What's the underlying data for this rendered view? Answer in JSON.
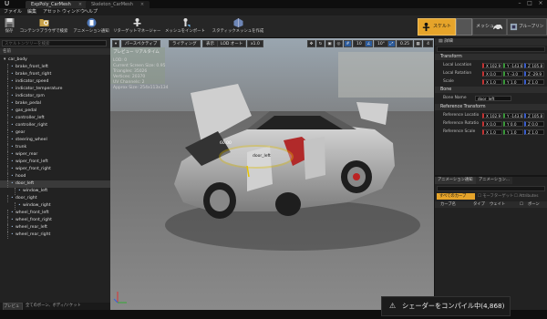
{
  "tabs": [
    {
      "label": "ExpPoly_CarMesh",
      "close": "×"
    },
    {
      "label": "Skeleton_CarMesh",
      "close": "×"
    }
  ],
  "window_controls": {
    "min": "–",
    "max": "□",
    "close": "×"
  },
  "menu": [
    "ファイル",
    "編集",
    "アセット",
    "ウィンドウ",
    "ヘルプ"
  ],
  "toolbar": {
    "buttons": [
      {
        "label": "保存",
        "icon": "save-icon"
      },
      {
        "label": "コンテンツブラウザで検索",
        "icon": "browse-icon"
      },
      {
        "label": "アニメーション通知",
        "icon": "notify-icon"
      },
      {
        "label": "リターゲットマネージャー",
        "icon": "retarget-icon"
      },
      {
        "label": "メッシュをインポート",
        "icon": "import-mesh-icon"
      },
      {
        "label": "スタティックメッシュを作成",
        "icon": "static-mesh-icon"
      }
    ],
    "modes": {
      "skeleton": "スケルトン",
      "mesh": "メッシュ",
      "blueprint": "ブループリント"
    }
  },
  "left_panel": {
    "search_placeholder": "スケルトンツリーを検索",
    "column_header": "名前",
    "footer": "全てのボーン、ボディ/ソケット"
  },
  "bones": [
    {
      "name": "car_body",
      "depth": 0
    },
    {
      "name": "brake_front_left",
      "depth": 1
    },
    {
      "name": "brake_front_right",
      "depth": 1
    },
    {
      "name": "indicator_speed",
      "depth": 1
    },
    {
      "name": "indicator_temperature",
      "depth": 1
    },
    {
      "name": "indicator_rpm",
      "depth": 1
    },
    {
      "name": "brake_pedal",
      "depth": 1
    },
    {
      "name": "gas_pedal",
      "depth": 1
    },
    {
      "name": "controller_left",
      "depth": 1
    },
    {
      "name": "controller_right",
      "depth": 1
    },
    {
      "name": "gear",
      "depth": 1
    },
    {
      "name": "steering_wheel",
      "depth": 1
    },
    {
      "name": "trunk",
      "depth": 1
    },
    {
      "name": "wiper_rear",
      "depth": 1
    },
    {
      "name": "wiper_front_left",
      "depth": 1
    },
    {
      "name": "wiper_front_right",
      "depth": 1
    },
    {
      "name": "hood",
      "depth": 1
    },
    {
      "name": "door_left",
      "depth": 1,
      "selected": true
    },
    {
      "name": "window_left",
      "depth": 2
    },
    {
      "name": "door_right",
      "depth": 1
    },
    {
      "name": "window_right",
      "depth": 2
    },
    {
      "name": "wheel_front_left",
      "depth": 1
    },
    {
      "name": "wheel_front_right",
      "depth": 1
    },
    {
      "name": "wheel_rear_left",
      "depth": 1
    },
    {
      "name": "wheel_rear_right",
      "depth": 1
    }
  ],
  "viewport": {
    "perspective": "パースペクティブ",
    "lighting": "ライティング",
    "show": "表示",
    "lod": "LOD オート",
    "speed": "x1.0",
    "grid": "10",
    "angle": "10°",
    "scale": "0.25",
    "camera": "4",
    "preview_label": "プレビュー リアルタイム",
    "stats": [
      "LOD: 0",
      "Current Screen Size: 0.95",
      "Triangles: 35026",
      "Vertices: 20370",
      "UV Channels: 2",
      "Approx Size: 254x113x134"
    ],
    "gizmo_bone": "door_left",
    "gizmo_angle": "60.00"
  },
  "details": {
    "title": "詳細",
    "transform": "Transform",
    "location_label": "Local Location",
    "location": [
      "X 102.9",
      "Y -143.6",
      "Z 105.8"
    ],
    "rotation_label": "Local Rotation",
    "rotation": [
      "X 0.0",
      "Y -3.0",
      "Z -29.9"
    ],
    "scale_label": "Scale",
    "scale": [
      "X 1.0",
      "Y 1.0",
      "Z 1.0"
    ],
    "bone_section": "Bone",
    "bone_name_label": "Bone Name",
    "bone_name": "door_left",
    "ref_section": "Reference Transform",
    "ref_location_label": "Reference Locatio",
    "ref_location": [
      "X 102.9",
      "Y -143.6",
      "Z 105.8"
    ],
    "ref_rotation_label": "Reference Rotatio",
    "ref_rotation": [
      "X 0.0",
      "Y 0.0",
      "Z 0.0"
    ],
    "ref_scale_label": "Reference Scale",
    "ref_scale": [
      "X 1.0",
      "Y 1.0",
      "Z 1.0"
    ]
  },
  "anim_panel": {
    "tab1": "アニメーション通知",
    "tab2": "アニメーション...",
    "filter_all": "すべてのカーブ",
    "morph": "モーフターゲット",
    "attributes": "Attributes",
    "columns": [
      "カーブ名",
      "タイプ",
      "ウェイト"
    ],
    "col_extra": "ボーン"
  },
  "toast": {
    "text": "シェーダーをコンパイル中(4,868)"
  },
  "status": {
    "preview_label": "プレビュー"
  },
  "colors": {
    "accent": "#e6a42a",
    "selection": "#2b5a9a",
    "panel": "#222222"
  }
}
